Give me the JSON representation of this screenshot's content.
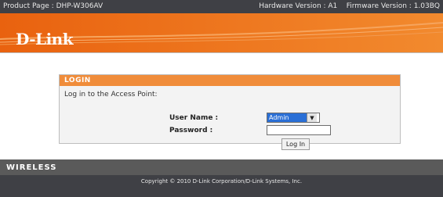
{
  "header": {
    "product_page": "Product Page : DHP-W306AV",
    "hardware_version": "Hardware Version : A1",
    "firmware_version": "Firmware Version : 1.03BQ"
  },
  "brand": {
    "logo_text": "D-Link"
  },
  "login": {
    "title": "LOGIN",
    "intro": "Log in to the Access Point:",
    "username_label": "User Name :",
    "username_value": "Admin",
    "password_label": "Password :",
    "password_value": "",
    "login_button": "Log In"
  },
  "footer": {
    "wireless_label": "WIRELESS",
    "copyright": "Copyright © 2010 D-Link Corporation/D-Link Systems, Inc."
  },
  "colors": {
    "top_bar": "#3f4045",
    "banner_orange": "#ee6a1b",
    "login_header": "#f08c3a",
    "footer_gray": "#5a5a5a"
  }
}
